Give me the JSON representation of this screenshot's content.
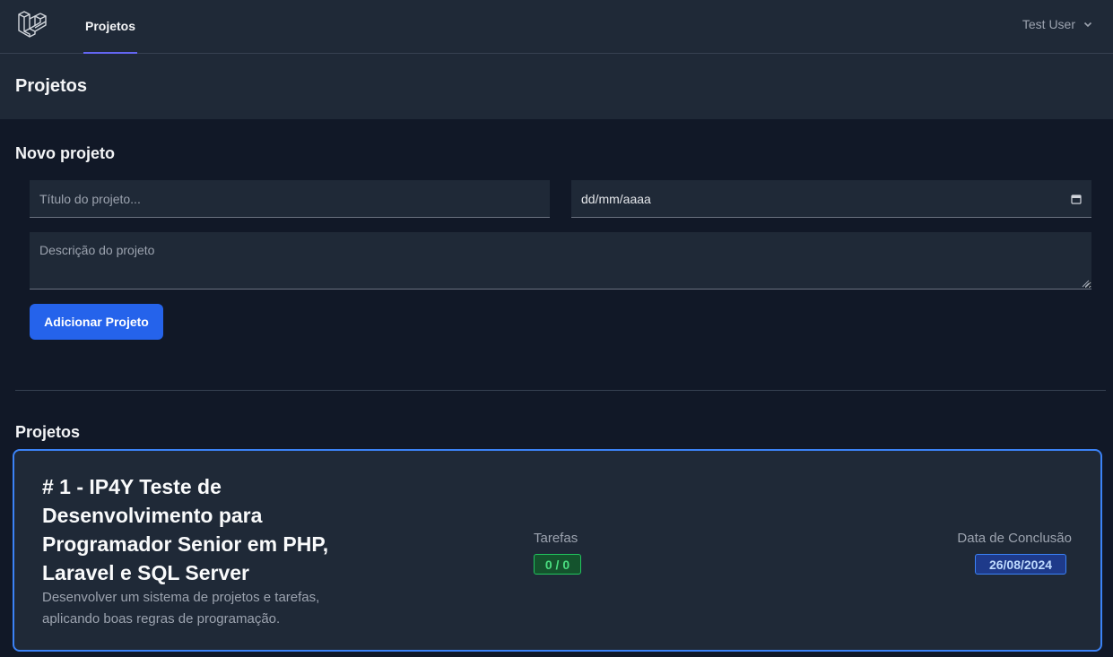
{
  "nav": {
    "logo_icon": "laravel-logo-icon",
    "links": [
      {
        "label": "Projetos",
        "active": true
      }
    ],
    "user_name": "Test User",
    "user_menu_icon": "chevron-down-icon"
  },
  "header": {
    "title": "Projetos"
  },
  "form": {
    "title": "Novo projeto",
    "title_placeholder": "Título do projeto...",
    "date_value": "dd/mm/aaaa",
    "date_icon": "calendar-icon",
    "description_placeholder": "Descrição do projeto",
    "submit_label": "Adicionar Projeto"
  },
  "projects": {
    "title": "Projetos",
    "items": [
      {
        "heading": "# 1 - IP4Y Teste de Desenvolvimento para Programador Senior em PHP, Laravel e SQL Server",
        "description": "Desenvolver um sistema de projetos e tarefas, aplicando boas regras de programação.",
        "tasks_label": "Tarefas",
        "tasks_value": "0 / 0",
        "date_label": "Data de Conclusão",
        "date_value": "26/08/2024"
      }
    ]
  },
  "colors": {
    "background": "#111827",
    "panel": "#1f2937",
    "accent": "#2563eb",
    "nav_indicator": "#6366f1",
    "card_border": "#3b82f6",
    "tasks_badge": "#22c55e"
  }
}
